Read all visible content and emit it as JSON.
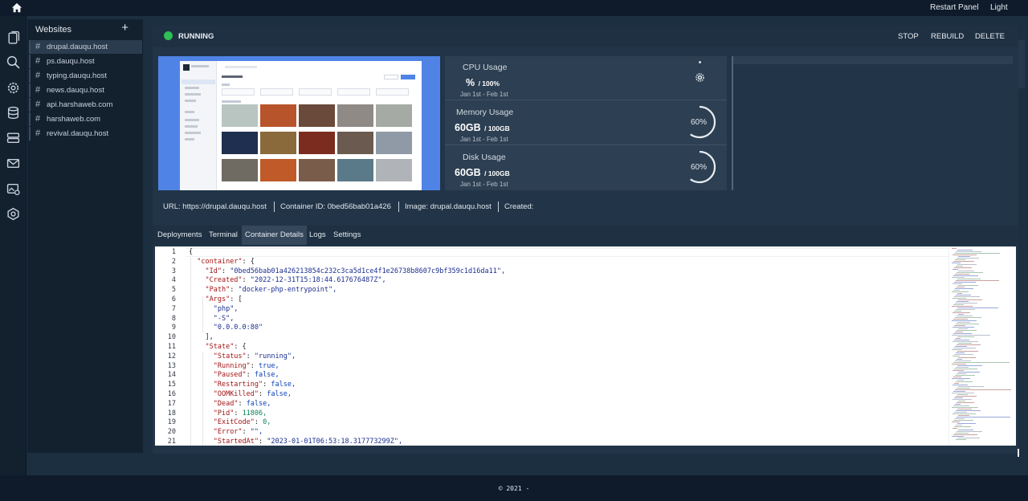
{
  "topbar": {
    "restart_label": "Restart Panel",
    "theme_label": "Light",
    "home_icon": "home-icon"
  },
  "rail": {
    "icons": [
      "files-icon",
      "search-icon",
      "settings-icon",
      "database-icon",
      "server-icon",
      "mail-icon",
      "image-settings-icon",
      "network-icon"
    ]
  },
  "websites": {
    "title": "Websites",
    "add_label": "+",
    "hash": "#",
    "items": [
      {
        "name": "drupal.dauqu.host"
      },
      {
        "name": "ps.dauqu.host"
      },
      {
        "name": "typing.dauqu.host"
      },
      {
        "name": "news.dauqu.host"
      },
      {
        "name": "api.harshaweb.com"
      },
      {
        "name": "harshaweb.com"
      },
      {
        "name": "revival.dauqu.host"
      }
    ]
  },
  "status": {
    "label": "RUNNING",
    "color": "#2fbf54"
  },
  "actions": {
    "stop": "STOP",
    "rebuild": "REBUILD",
    "delete": "DELETE"
  },
  "metrics": {
    "cpu": {
      "title": "CPU Usage",
      "value": "%",
      "max": "/ 100%",
      "range": "Jan 1st - Feb 1st"
    },
    "memory": {
      "title": "Memory Usage",
      "value": "60GB",
      "max": "/ 100GB",
      "range": "Jan 1st - Feb 1st",
      "percent_label": "60%",
      "percent": 60
    },
    "disk": {
      "title": "Disk Usage",
      "value": "60GB",
      "max": "/ 100GB",
      "range": "Jan 1st - Feb 1st",
      "percent_label": "60%",
      "percent": 60
    }
  },
  "info": {
    "url": "URL: https://drupal.dauqu.host",
    "container_id": "Container ID: 0bed56bab01a426",
    "image": "Image: drupal.dauqu.host",
    "created": "Created:"
  },
  "tabs": [
    {
      "label": "Deployments"
    },
    {
      "label": "Terminal"
    },
    {
      "label": "Container Details"
    },
    {
      "label": "Logs"
    },
    {
      "label": "Settings"
    }
  ],
  "editor": {
    "line_numbers": [
      "1",
      "2",
      "3",
      "4",
      "5",
      "6",
      "7",
      "8",
      "9",
      "10",
      "11",
      "12",
      "13",
      "14",
      "15",
      "16",
      "17",
      "18",
      "19",
      "20",
      "21"
    ],
    "lines": [
      {
        "indent": "",
        "key": "",
        "sep": "{",
        "val": "",
        "vtype": ""
      },
      {
        "indent": "  ",
        "key": "\"container\"",
        "sep": ": {",
        "val": "",
        "vtype": ""
      },
      {
        "indent": "    ",
        "key": "\"Id\"",
        "sep": ": ",
        "val": "\"0bed56bab01a426213854c232c3ca5d1ce4f1e26738b8607c9bf359c1d16da11\",",
        "vtype": "s"
      },
      {
        "indent": "    ",
        "key": "\"Created\"",
        "sep": ": ",
        "val": "\"2022-12-31T15:18:44.617676487Z\",",
        "vtype": "s"
      },
      {
        "indent": "    ",
        "key": "\"Path\"",
        "sep": ": ",
        "val": "\"docker-php-entrypoint\",",
        "vtype": "s"
      },
      {
        "indent": "    ",
        "key": "\"Args\"",
        "sep": ": [",
        "val": "",
        "vtype": ""
      },
      {
        "indent": "      ",
        "key": "",
        "sep": "",
        "val": "\"php\",",
        "vtype": "s"
      },
      {
        "indent": "      ",
        "key": "",
        "sep": "",
        "val": "\"-S\",",
        "vtype": "s"
      },
      {
        "indent": "      ",
        "key": "",
        "sep": "",
        "val": "\"0.0.0.0:80\"",
        "vtype": "s"
      },
      {
        "indent": "    ",
        "key": "",
        "sep": "],",
        "val": "",
        "vtype": ""
      },
      {
        "indent": "    ",
        "key": "\"State\"",
        "sep": ": {",
        "val": "",
        "vtype": ""
      },
      {
        "indent": "      ",
        "key": "\"Status\"",
        "sep": ": ",
        "val": "\"running\",",
        "vtype": "s"
      },
      {
        "indent": "      ",
        "key": "\"Running\"",
        "sep": ": ",
        "val": "true,",
        "vtype": "b"
      },
      {
        "indent": "      ",
        "key": "\"Paused\"",
        "sep": ": ",
        "val": "false,",
        "vtype": "b"
      },
      {
        "indent": "      ",
        "key": "\"Restarting\"",
        "sep": ": ",
        "val": "false,",
        "vtype": "b"
      },
      {
        "indent": "      ",
        "key": "\"OOMKilled\"",
        "sep": ": ",
        "val": "false,",
        "vtype": "b"
      },
      {
        "indent": "      ",
        "key": "\"Dead\"",
        "sep": ": ",
        "val": "false,",
        "vtype": "b"
      },
      {
        "indent": "      ",
        "key": "\"Pid\"",
        "sep": ": ",
        "val": "11806,",
        "vtype": "n"
      },
      {
        "indent": "      ",
        "key": "\"ExitCode\"",
        "sep": ": ",
        "val": "0,",
        "vtype": "n"
      },
      {
        "indent": "      ",
        "key": "\"Error\"",
        "sep": ": ",
        "val": "\"\",",
        "vtype": "s"
      },
      {
        "indent": "      ",
        "key": "\"StartedAt\"",
        "sep": ": ",
        "val": "\"2023-01-01T06:53:18.317773299Z\",",
        "vtype": "s"
      }
    ]
  },
  "footer": {
    "text": "© 2021 -"
  }
}
